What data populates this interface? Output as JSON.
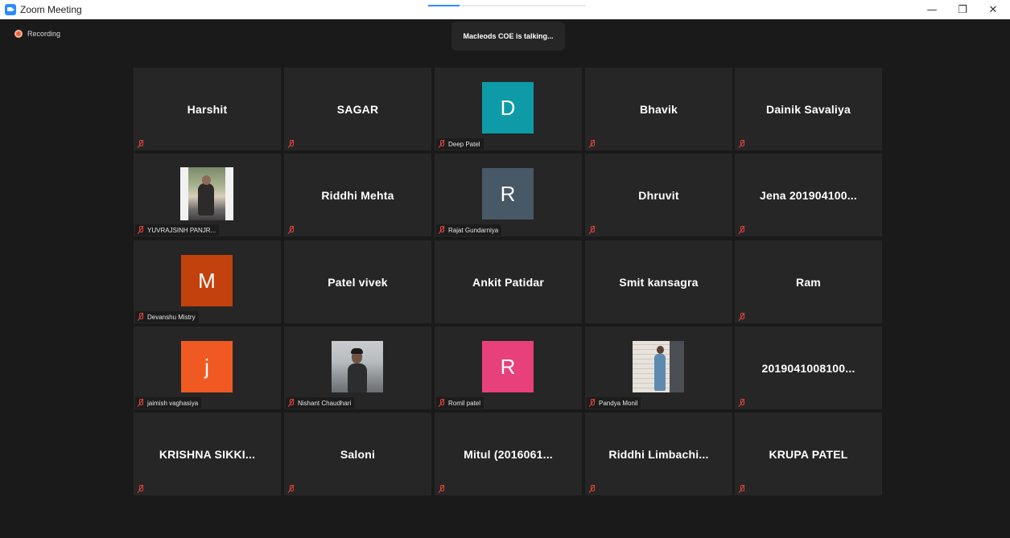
{
  "window": {
    "title": "Zoom Meeting",
    "controls": {
      "minimize": "—",
      "restore": "❐",
      "close": "✕"
    },
    "progress": 0.2
  },
  "meeting": {
    "recording_label": "Recording",
    "active_speaker": "Macleods COE is talking..."
  },
  "colors": {
    "background": "#1a1a1a",
    "tile": "#262626",
    "muted_icon": "#e0433b",
    "recording": "#e8623b"
  },
  "participants": [
    {
      "name": "Harshit",
      "display": "name",
      "muted": true
    },
    {
      "name": "SAGAR",
      "display": "name",
      "muted": true
    },
    {
      "name": "Deep Patel",
      "display": "avatar",
      "initial": "D",
      "avatar_color": "#0e9aa7",
      "muted": true
    },
    {
      "name": "Bhavik",
      "display": "name",
      "muted": true
    },
    {
      "name": "Dainik Savaliya",
      "display": "name",
      "muted": true
    },
    {
      "name": "YUVRAJSINH PANJR...",
      "display": "photo",
      "muted": true
    },
    {
      "name": "Riddhi Mehta",
      "display": "name",
      "muted": true
    },
    {
      "name": "Rajat Gundarniya",
      "display": "avatar",
      "initial": "R",
      "avatar_color": "#475866",
      "muted": true
    },
    {
      "name": "Dhruvit",
      "display": "name",
      "muted": true
    },
    {
      "name": "Jena  201904100...",
      "display": "name",
      "muted": true
    },
    {
      "name": "Devanshu Mistry",
      "display": "avatar",
      "initial": "M",
      "avatar_color": "#c2410c",
      "muted": true
    },
    {
      "name": "Patel vivek",
      "display": "name",
      "muted": false
    },
    {
      "name": "Ankit Patidar",
      "display": "name",
      "muted": false
    },
    {
      "name": "Smit kansagra",
      "display": "name",
      "muted": false
    },
    {
      "name": "Ram",
      "display": "name",
      "muted": true
    },
    {
      "name": "jaimish vaghasiya",
      "display": "avatar",
      "initial": "j",
      "avatar_color": "#f05a22",
      "muted": true
    },
    {
      "name": "Nishant Chaudhari",
      "display": "photo",
      "muted": true
    },
    {
      "name": "Romil patel",
      "display": "avatar",
      "initial": "R",
      "avatar_color": "#e8407a",
      "muted": true
    },
    {
      "name": "Pandya Monil",
      "display": "photo",
      "muted": true
    },
    {
      "name": "2019041008100...",
      "display": "name",
      "muted": true
    },
    {
      "name": "KRISHNA  SIKKI...",
      "display": "name",
      "muted": true
    },
    {
      "name": "Saloni",
      "display": "name",
      "muted": true
    },
    {
      "name": "Mitul  (2016061...",
      "display": "name",
      "muted": true
    },
    {
      "name": "Riddhi  Limbachi...",
      "display": "name",
      "muted": true
    },
    {
      "name": "KRUPA PATEL",
      "display": "name",
      "muted": true
    }
  ]
}
